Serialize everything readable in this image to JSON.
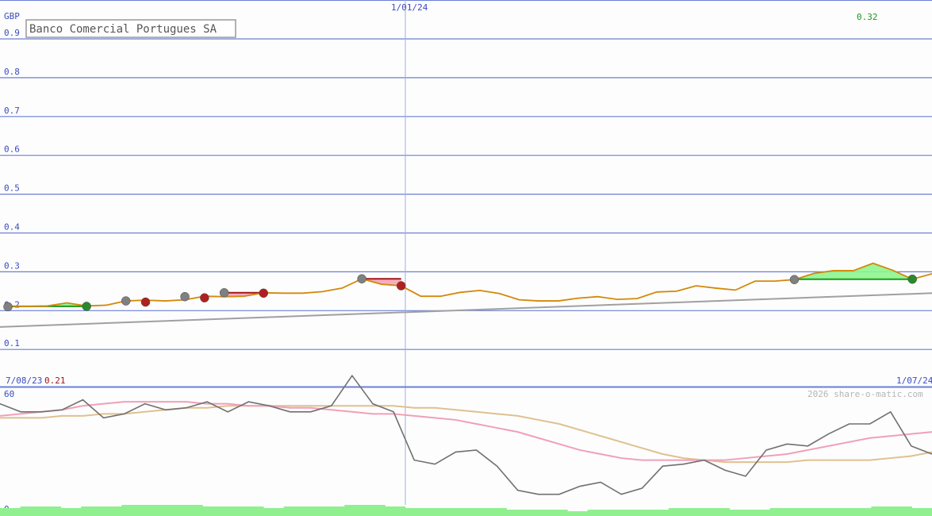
{
  "chart_data": {
    "type": "line",
    "title": "Banco Comercial Portugues SA",
    "currency_label": "GBP",
    "top_right_value": "0.32",
    "low_value_label": "0.21",
    "start_date_label": "7/08/23",
    "mid_date_label": "1/01/24",
    "end_date_label": "1/07/24",
    "credit": "2026 share-o-matic.com",
    "y_ticks": [
      "0.9",
      "0.8",
      "0.7",
      "0.6",
      "0.5",
      "0.4",
      "0.3",
      "0.2",
      "0.1"
    ],
    "ylim": [
      0.0,
      1.0
    ],
    "grid": true,
    "colors": {
      "price": "#d4880a",
      "trend": "#a0a0a0",
      "grid": "#6b7fd7",
      "up_fill": "#8ef58e",
      "up_line": "#1a9a1a",
      "down_fill": "#f5a3b8",
      "down_line": "#a01818",
      "marker_gray": "#808080",
      "marker_red": "#b02020",
      "marker_green": "#2a8a2a",
      "osc_price": "#707070",
      "osc_pink": "#f0a0b8",
      "osc_tan": "#e0c090",
      "volume": "#90f090"
    },
    "price_series": {
      "name": "",
      "x": [
        "2023-08-07",
        "2023-08-14",
        "2023-08-21",
        "2023-08-28",
        "2023-09-04",
        "2023-09-11",
        "2023-09-18",
        "2023-09-25",
        "2023-10-02",
        "2023-10-09",
        "2023-10-16",
        "2023-10-23",
        "2023-10-30",
        "2023-11-06",
        "2023-11-13",
        "2023-11-20",
        "2023-11-27",
        "2023-12-04",
        "2023-12-11",
        "2023-12-18",
        "2023-12-25",
        "2024-01-01",
        "2024-01-08",
        "2024-01-15",
        "2024-01-22",
        "2024-01-29",
        "2024-02-05",
        "2024-02-12",
        "2024-02-19",
        "2024-02-26",
        "2024-03-04",
        "2024-03-11",
        "2024-03-18",
        "2024-03-25",
        "2024-04-01",
        "2024-04-08",
        "2024-04-15",
        "2024-04-22",
        "2024-04-29",
        "2024-05-06",
        "2024-05-13",
        "2024-05-20",
        "2024-05-27",
        "2024-06-03",
        "2024-06-10",
        "2024-06-17",
        "2024-06-24",
        "2024-07-01"
      ],
      "values": [
        0.21,
        0.211,
        0.212,
        0.22,
        0.212,
        0.214,
        0.225,
        0.227,
        0.225,
        0.228,
        0.237,
        0.236,
        0.237,
        0.246,
        0.245,
        0.245,
        0.249,
        0.258,
        0.282,
        0.268,
        0.264,
        0.237,
        0.237,
        0.247,
        0.252,
        0.244,
        0.228,
        0.225,
        0.225,
        0.232,
        0.236,
        0.229,
        0.231,
        0.248,
        0.25,
        0.264,
        0.258,
        0.253,
        0.276,
        0.276,
        0.28,
        0.296,
        0.303,
        0.303,
        0.322,
        0.304,
        0.281,
        0.295
      ]
    },
    "trend_series": {
      "name": "",
      "x": [
        "2023-08-07",
        "2024-07-01"
      ],
      "values": [
        0.16,
        0.245
      ]
    },
    "markers": [
      {
        "date": "2023-08-07",
        "value": 0.21,
        "kind": "gray"
      },
      {
        "date": "2023-09-04",
        "value": 0.211,
        "kind": "green"
      },
      {
        "date": "2023-09-18",
        "value": 0.225,
        "kind": "gray"
      },
      {
        "date": "2023-09-25",
        "value": 0.222,
        "kind": "red"
      },
      {
        "date": "2023-10-09",
        "value": 0.236,
        "kind": "gray"
      },
      {
        "date": "2023-10-16",
        "value": 0.233,
        "kind": "red"
      },
      {
        "date": "2023-10-23",
        "value": 0.246,
        "kind": "gray"
      },
      {
        "date": "2023-11-06",
        "value": 0.245,
        "kind": "red"
      },
      {
        "date": "2023-12-11",
        "value": 0.282,
        "kind": "gray"
      },
      {
        "date": "2023-12-25",
        "value": 0.264,
        "kind": "red"
      },
      {
        "date": "2024-05-13",
        "value": 0.28,
        "kind": "gray"
      },
      {
        "date": "2024-06-24",
        "value": 0.281,
        "kind": "green"
      }
    ],
    "up_bands": [
      {
        "from": "2023-08-07",
        "to": "2023-09-04",
        "level": 0.211
      },
      {
        "from": "2024-05-13",
        "to": "2024-06-24",
        "level": 0.281
      }
    ],
    "down_bands": [
      {
        "from": "2023-10-23",
        "to": "2023-11-06",
        "level": 0.246
      },
      {
        "from": "2023-12-11",
        "to": "2023-12-25",
        "level": 0.282
      }
    ],
    "oscillator": {
      "y_top_label": "60",
      "y_bottom_label": "0",
      "ylim": [
        0,
        60
      ],
      "price_line": [
        55,
        51,
        51,
        52,
        57,
        48,
        50,
        55,
        52,
        53,
        56,
        51,
        56,
        54,
        51,
        51,
        54,
        69,
        55,
        51,
        27,
        25,
        31,
        32,
        24,
        12,
        10,
        10,
        14,
        16,
        10,
        13,
        24,
        25,
        27,
        22,
        19,
        32,
        35,
        34,
        40,
        45,
        45,
        51,
        34,
        30
      ],
      "pink_line": [
        49,
        50,
        51,
        52,
        54,
        55,
        56,
        56,
        56,
        56,
        55,
        55,
        54,
        54,
        53,
        53,
        52,
        51,
        50,
        50,
        49,
        48,
        47,
        45,
        43,
        41,
        38,
        35,
        32,
        30,
        28,
        27,
        27,
        27,
        27,
        27,
        28,
        29,
        30,
        32,
        34,
        36,
        38,
        39,
        40,
        41
      ],
      "tan_line": [
        48,
        48,
        48,
        49,
        49,
        50,
        50,
        51,
        52,
        53,
        53,
        54,
        54,
        54,
        54,
        54,
        54,
        54,
        54,
        54,
        53,
        53,
        52,
        51,
        50,
        49,
        47,
        45,
        42,
        39,
        36,
        33,
        30,
        28,
        27,
        26,
        26,
        26,
        26,
        27,
        27,
        27,
        27,
        28,
        29,
        31
      ],
      "volume": [
        4,
        5,
        5,
        4,
        5,
        5,
        6,
        6,
        6,
        6,
        5,
        5,
        5,
        4,
        5,
        5,
        5,
        6,
        6,
        5,
        4,
        4,
        4,
        4,
        4,
        3,
        3,
        3,
        2,
        3,
        3,
        3,
        3,
        4,
        4,
        4,
        3,
        3,
        4,
        4,
        4,
        4,
        4,
        5,
        5,
        4
      ]
    }
  }
}
